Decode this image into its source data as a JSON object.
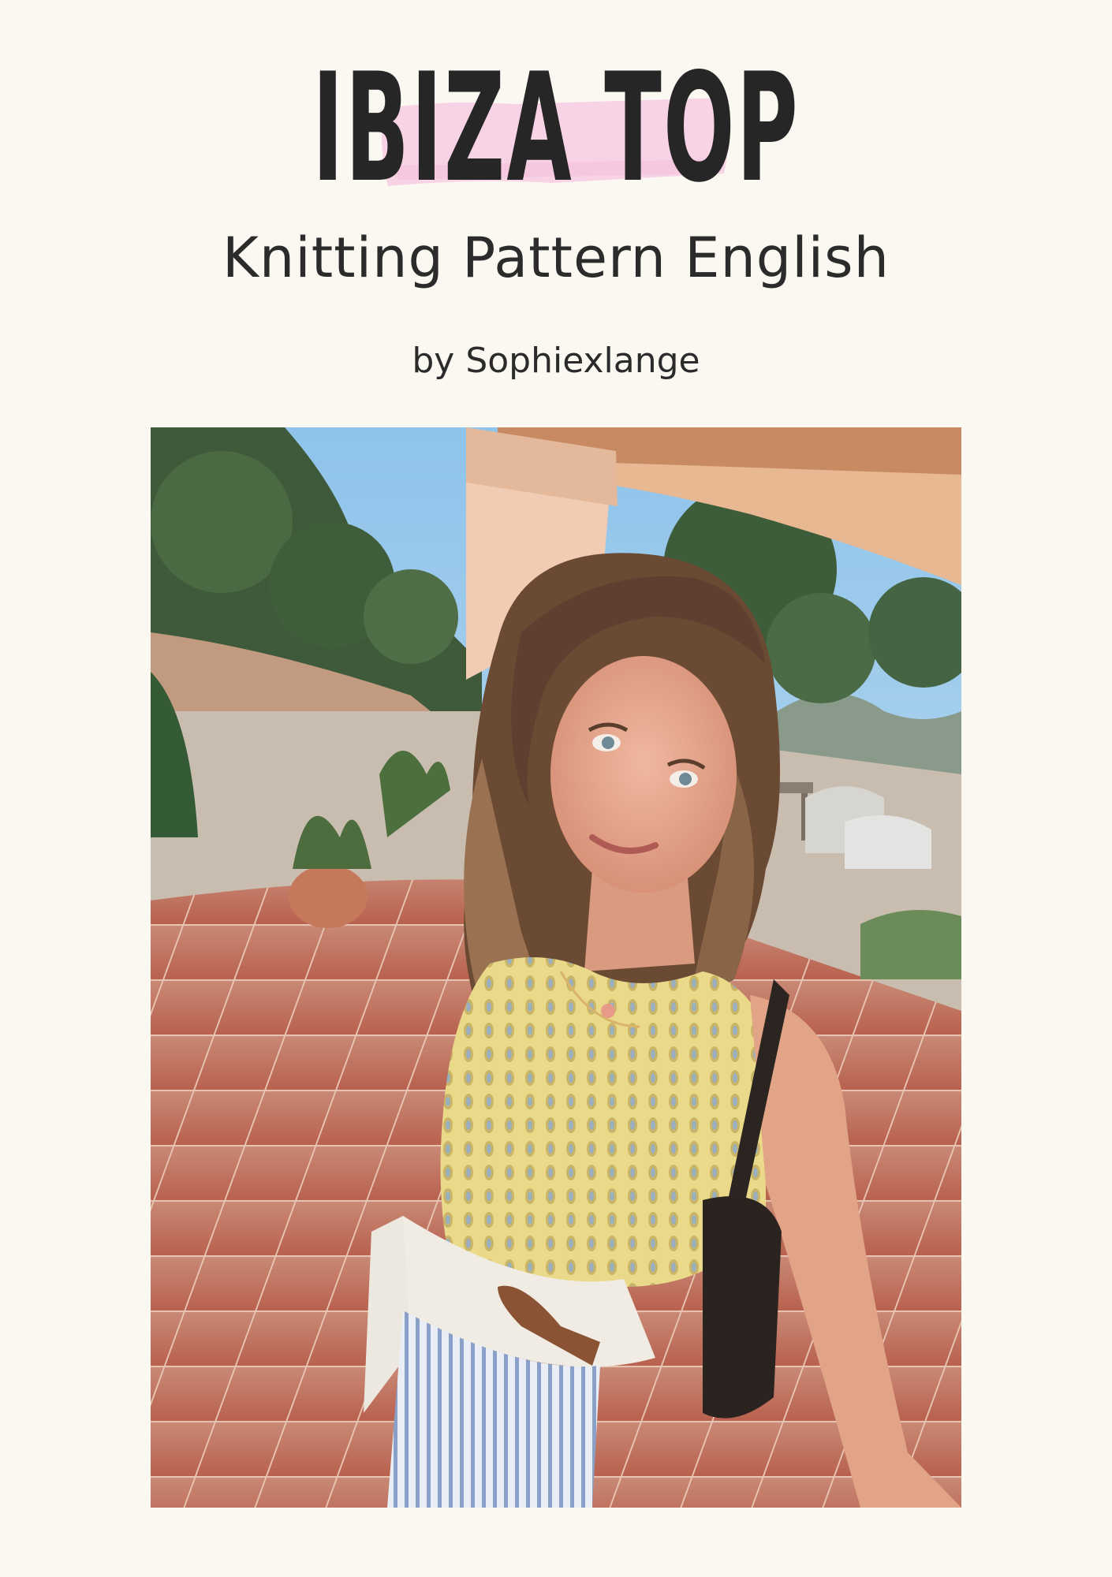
{
  "cover": {
    "title": "IBIZA TOP",
    "subtitle": "Knitting Pattern English",
    "byline": "by Sophiexlange"
  },
  "colors": {
    "background": "#faf8f1",
    "text": "#262626",
    "title_highlight": "#f8d3e6"
  }
}
